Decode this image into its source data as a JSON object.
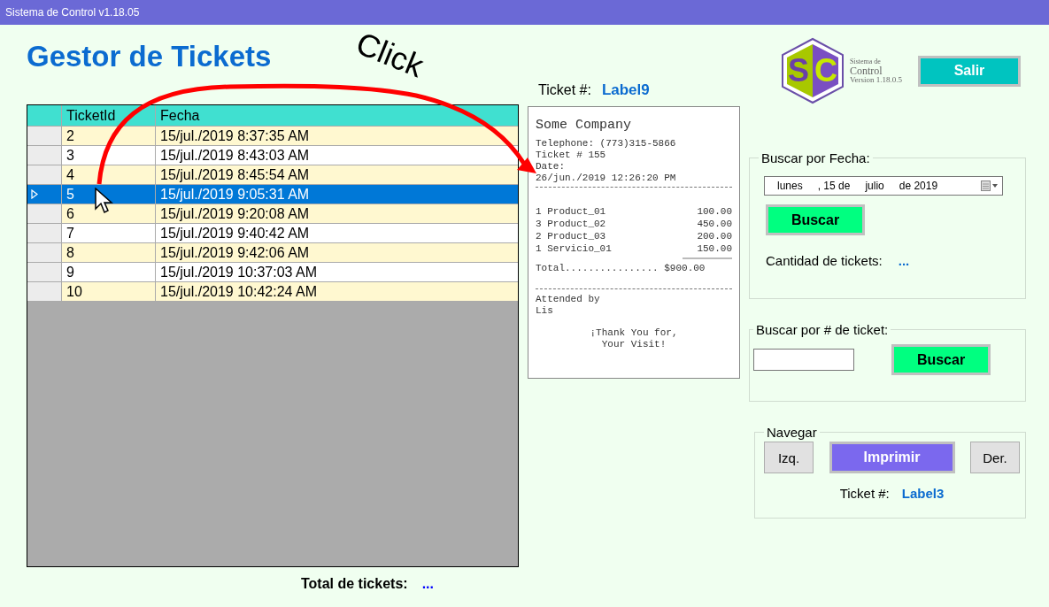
{
  "window": {
    "title": "Sistema de Control v1.18.05"
  },
  "heading": "Gestor de Tickets",
  "annotation": {
    "label": "Click"
  },
  "table": {
    "columns": [
      "TicketId",
      "Fecha"
    ],
    "rows": [
      {
        "id": "2",
        "fecha": "15/jul./2019 8:37:35 AM",
        "selected": false
      },
      {
        "id": "3",
        "fecha": "15/jul./2019 8:43:03 AM",
        "selected": false
      },
      {
        "id": "4",
        "fecha": "15/jul./2019 8:45:54 AM",
        "selected": false
      },
      {
        "id": "5",
        "fecha": "15/jul./2019 9:05:31 AM",
        "selected": true
      },
      {
        "id": "6",
        "fecha": "15/jul./2019 9:20:08 AM",
        "selected": false
      },
      {
        "id": "7",
        "fecha": "15/jul./2019 9:40:42 AM",
        "selected": false
      },
      {
        "id": "8",
        "fecha": "15/jul./2019 9:42:06 AM",
        "selected": false
      },
      {
        "id": "9",
        "fecha": "15/jul./2019 10:37:03 AM",
        "selected": false
      },
      {
        "id": "10",
        "fecha": "15/jul./2019 10:42:24 AM",
        "selected": false
      }
    ]
  },
  "total": {
    "label": "Total de tickets:",
    "value": "..."
  },
  "ticket_label": {
    "label": "Ticket #:",
    "value": "Label9"
  },
  "receipt": {
    "company": "Some Company",
    "header": [
      "Telephone: (773)315-5866",
      "Ticket # 155",
      "Date:",
      "26/jun./2019 12:26:20 PM"
    ],
    "items": [
      {
        "qty": "1",
        "name": "Product_01",
        "amount": "100.00"
      },
      {
        "qty": "3",
        "name": "Product_02",
        "amount": "450.00"
      },
      {
        "qty": "2",
        "name": "Product_03",
        "amount": "200.00"
      },
      {
        "qty": "1",
        "name": "Servicio_01",
        "amount": "150.00"
      }
    ],
    "total": "Total................ $900.00",
    "footer": [
      "Attended by",
      "Lis"
    ],
    "thanks": [
      "¡Thank You for,",
      "Your Visit!"
    ]
  },
  "logo": {
    "letters": "SC",
    "line1": "Sistema de",
    "line2": "Control",
    "line3": "Version 1.18.0.5"
  },
  "exit_button": "Salir",
  "date_search": {
    "title": "Buscar por Fecha:",
    "date_parts": [
      "lunes",
      ", 15 de",
      "julio",
      "de 2019"
    ],
    "button": "Buscar",
    "count_label": "Cantidad de tickets:",
    "count_value": "..."
  },
  "number_search": {
    "title": "Buscar por # de ticket:",
    "button": "Buscar"
  },
  "navigate": {
    "title": "Navegar",
    "left": "Izq.",
    "print": "Imprimir",
    "right": "Der.",
    "ticket_label": "Ticket #:",
    "ticket_value": "Label3"
  }
}
